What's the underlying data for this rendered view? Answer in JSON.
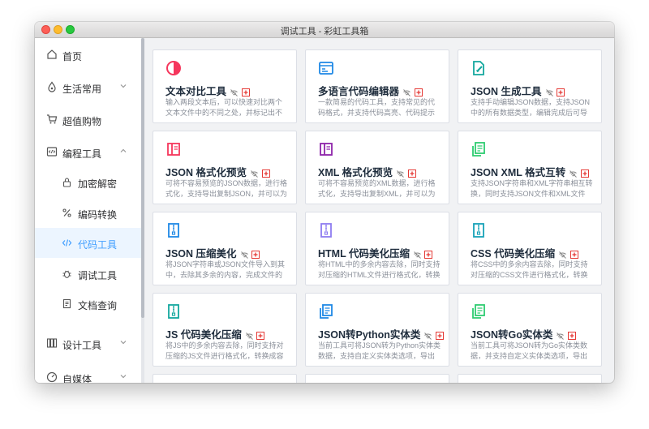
{
  "window": {
    "title": "调试工具 - 彩虹工具箱"
  },
  "sidebar": {
    "items": [
      {
        "label": "首页",
        "icon": "home-icon"
      },
      {
        "label": "生活常用",
        "icon": "droplet-icon"
      },
      {
        "label": "超值购物",
        "icon": "cart-icon"
      },
      {
        "label": "编程工具",
        "icon": "code-file-icon"
      },
      {
        "label": "设计工具",
        "icon": "design-icon"
      },
      {
        "label": "自媒体",
        "icon": "media-icon"
      }
    ],
    "sub_items": [
      {
        "label": "加密解密",
        "icon": "lock-icon"
      },
      {
        "label": "编码转换",
        "icon": "percent-icon"
      },
      {
        "label": "代码工具",
        "icon": "code-icon",
        "active": true
      },
      {
        "label": "调试工具",
        "icon": "bug-icon"
      },
      {
        "label": "文档查询",
        "icon": "document-icon"
      }
    ]
  },
  "tools": [
    {
      "title": "文本对比工具",
      "desc": "输入两段文本后，可以快速对比两个文本文件中的不同之处，并标记出不同的地...",
      "icon": "contrast-icon",
      "color": "#f5365c"
    },
    {
      "title": "多语言代码编辑器",
      "desc": "一款简易的代码工具，支持常见的代码格式，并支持代码高亮、代码提示功能，...",
      "icon": "code-window-icon",
      "color": "#1e88e5"
    },
    {
      "title": "JSON 生成工具",
      "desc": "支持手动编辑JSON数据，支持JSON中的所有数据类型，编辑完成后可导出JSO...",
      "icon": "json-edit-icon",
      "color": "#13a89e"
    },
    {
      "title": "JSON 格式化预览",
      "desc": "可将不容易预览的JSON数据，进行格式化，支持导出复制JSON，并可以为您...",
      "icon": "book-icon",
      "color": "#f5365c"
    },
    {
      "title": "XML 格式化预览",
      "desc": "可将不容易预览的XML数据，进行格式化，支持导出复制XML，并可以为您展...",
      "icon": "book-icon",
      "color": "#8e24aa"
    },
    {
      "title": "JSON XML 格式互转",
      "desc": "支持JSON字符串和XML字符串相互转换，同时支持JSON文件和XML文件的...",
      "icon": "copy-file-icon",
      "color": "#2ecc71"
    },
    {
      "title": "JSON 压缩美化",
      "desc": "将JSON字符串或JSON文件导入到其中，去除其多余的内容，完成文件的压缩后...",
      "icon": "zip-icon",
      "color": "#1e88e5"
    },
    {
      "title": "HTML 代码美化压缩",
      "desc": "将HTML中的多余内容去除，同时支持对压缩的HTML文件进行格式化，转换成...",
      "icon": "zip-icon",
      "color": "#8e7cf0"
    },
    {
      "title": "CSS 代码美化压缩",
      "desc": "将CSS中的多余内容去除，同时支持对压缩的CSS文件进行格式化，转换成容易...",
      "icon": "zip-icon",
      "color": "#17a2b8"
    },
    {
      "title": "JS 代码美化压缩",
      "desc": "将JS中的多余内容去除，同时支持对压缩的JS文件进行格式化，转换成容易阅读...",
      "icon": "zip-icon",
      "color": "#13a89e"
    },
    {
      "title": "JSON转Python实体类",
      "desc": "当前工具可将JSON转为Python实体类数据，支持自定义实体类选项，导出包...",
      "icon": "copy-file-icon",
      "color": "#1e88e5"
    },
    {
      "title": "JSON转Go实体类",
      "desc": "当前工具可将JSON转为Go实体类数据，并支持自定义实体类选项，导出包含注...",
      "icon": "copy-file-icon",
      "color": "#2ecc71"
    },
    {
      "title": "",
      "desc": "",
      "icon": "tool-icon",
      "color": "#8e7cf0"
    },
    {
      "title": "",
      "desc": "",
      "icon": "tool-icon",
      "color": "#f5a623"
    },
    {
      "title": "",
      "desc": "",
      "icon": "tool-icon",
      "color": "#f062b9"
    }
  ],
  "badge_icons": [
    "no-wifi-icon",
    "offline-plus-icon"
  ],
  "colors": {
    "accent": "#409eff",
    "badge_red": "#e53935"
  }
}
